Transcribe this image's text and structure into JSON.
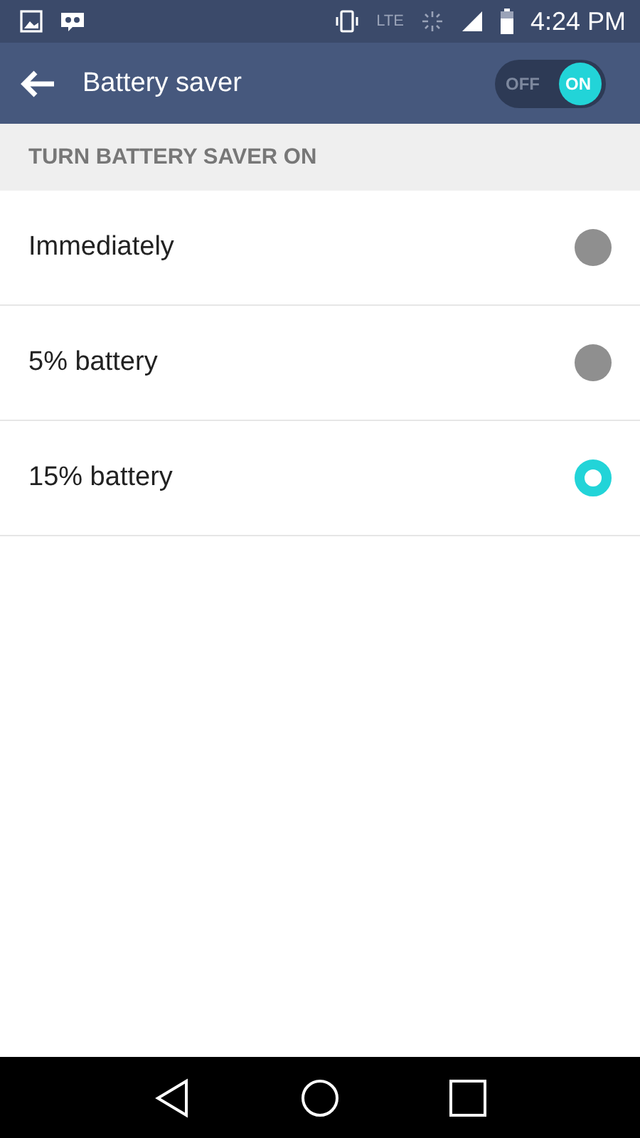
{
  "status_bar": {
    "network": "LTE",
    "time": "4:24 PM"
  },
  "toolbar": {
    "title": "Battery saver",
    "switch": {
      "off_label": "OFF",
      "on_label": "ON",
      "on": true
    }
  },
  "section_header": "TURN BATTERY SAVER ON",
  "options": [
    {
      "label": "Immediately",
      "selected": false
    },
    {
      "label": "5% battery",
      "selected": false
    },
    {
      "label": "15% battery",
      "selected": true
    }
  ]
}
